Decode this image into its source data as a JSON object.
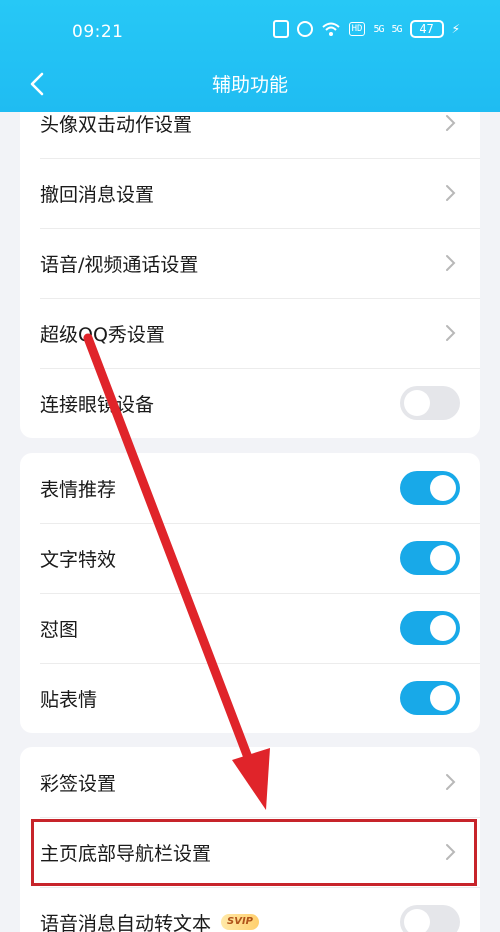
{
  "status_bar": {
    "time": "09:21",
    "hd": "HD",
    "signal1": "5G",
    "signal2": "5G",
    "battery": "47"
  },
  "nav": {
    "title": "辅助功能"
  },
  "group1": {
    "items": [
      {
        "label": "头像双击动作设置",
        "type": "link"
      },
      {
        "label": "撤回消息设置",
        "type": "link"
      },
      {
        "label": "语音/视频通话设置",
        "type": "link"
      },
      {
        "label": "超级QQ秀设置",
        "type": "link"
      },
      {
        "label": "连接眼镜设备",
        "type": "toggle",
        "on": false
      }
    ]
  },
  "group2": {
    "items": [
      {
        "label": "表情推荐",
        "type": "toggle",
        "on": true
      },
      {
        "label": "文字特效",
        "type": "toggle",
        "on": true
      },
      {
        "label": "怼图",
        "type": "toggle",
        "on": true
      },
      {
        "label": "贴表情",
        "type": "toggle",
        "on": true
      }
    ]
  },
  "group3": {
    "items": [
      {
        "label": "彩签设置",
        "type": "link"
      },
      {
        "label": "主页底部导航栏设置",
        "type": "link"
      },
      {
        "label": "语音消息自动转文本",
        "type": "toggle",
        "on": false,
        "badge": "SVIP"
      }
    ]
  },
  "colors": {
    "accent": "#18a9e8",
    "header": "#1fbcf2",
    "annotation": "#c7242a"
  }
}
